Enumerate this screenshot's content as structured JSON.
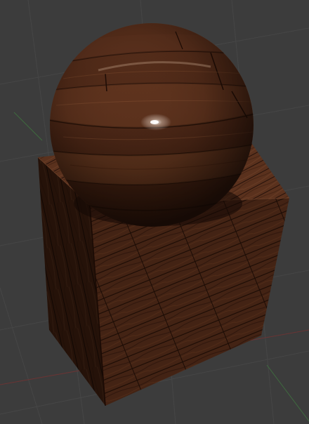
{
  "viewport": {
    "background_color": "#3c3c3c",
    "grid_color": "#474747",
    "axis_x_color": "#8a3a3a",
    "axis_y_color": "#3f6a3f"
  },
  "scene": {
    "objects": [
      {
        "kind": "sphere",
        "material": "wood-planks"
      },
      {
        "kind": "cube",
        "material": "wood-planks"
      }
    ],
    "wood_colors": {
      "dark": "#2a140b",
      "mid": "#4a2717",
      "light": "#6e3f27",
      "highlight": "#8a5535"
    }
  }
}
